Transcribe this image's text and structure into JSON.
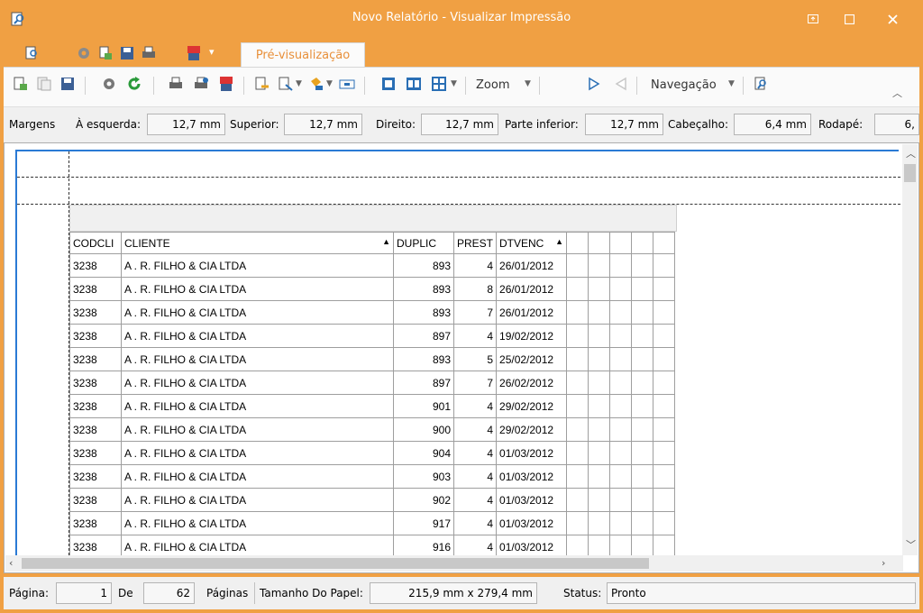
{
  "window": {
    "title": "Novo Relatório - Visualizar Impressão"
  },
  "tabs": {
    "preview": "Pré-visualização"
  },
  "ribbon": {
    "zoom_label": "Zoom",
    "nav_label": "Navegação"
  },
  "margins": {
    "label": "Margens",
    "left_label": "À esquerda:",
    "left": "12,7 mm",
    "top_label": "Superior:",
    "top": "12,7 mm",
    "right_label": "Direito:",
    "right": "12,7 mm",
    "bottom_label": "Parte inferior:",
    "bottom": "12,7 mm",
    "header_label": "Cabeçalho:",
    "header": "6,4 mm",
    "footer_label": "Rodapé:",
    "footer": "6,"
  },
  "report": {
    "columns": [
      "CODCLI",
      "CLIENTE",
      "DUPLIC",
      "PREST",
      "DTVENC"
    ],
    "rows": [
      [
        "3238",
        "A . R.  FILHO & CIA LTDA",
        "893",
        "4",
        "26/01/2012"
      ],
      [
        "3238",
        "A . R.  FILHO & CIA LTDA",
        "893",
        "8",
        "26/01/2012"
      ],
      [
        "3238",
        "A . R.  FILHO & CIA LTDA",
        "893",
        "7",
        "26/01/2012"
      ],
      [
        "3238",
        "A . R.  FILHO & CIA LTDA",
        "897",
        "4",
        "19/02/2012"
      ],
      [
        "3238",
        "A . R.  FILHO & CIA LTDA",
        "893",
        "5",
        "25/02/2012"
      ],
      [
        "3238",
        "A . R.  FILHO & CIA LTDA",
        "897",
        "7",
        "26/02/2012"
      ],
      [
        "3238",
        "A . R.  FILHO & CIA LTDA",
        "901",
        "4",
        "29/02/2012"
      ],
      [
        "3238",
        "A . R.  FILHO & CIA LTDA",
        "900",
        "4",
        "29/02/2012"
      ],
      [
        "3238",
        "A . R.  FILHO & CIA LTDA",
        "904",
        "4",
        "01/03/2012"
      ],
      [
        "3238",
        "A . R.  FILHO & CIA LTDA",
        "903",
        "4",
        "01/03/2012"
      ],
      [
        "3238",
        "A . R.  FILHO & CIA LTDA",
        "902",
        "4",
        "01/03/2012"
      ],
      [
        "3238",
        "A . R.  FILHO & CIA LTDA",
        "917",
        "4",
        "01/03/2012"
      ],
      [
        "3238",
        "A . R.  FILHO & CIA LTDA",
        "916",
        "4",
        "01/03/2012"
      ]
    ]
  },
  "status": {
    "page_label": "Página:",
    "page": "1",
    "of_label": "De",
    "total": "62",
    "pages_label": "Páginas",
    "paper_label": "Tamanho Do Papel:",
    "paper": "215,9 mm x 279,4 mm",
    "status_label": "Status:",
    "status": "Pronto"
  }
}
